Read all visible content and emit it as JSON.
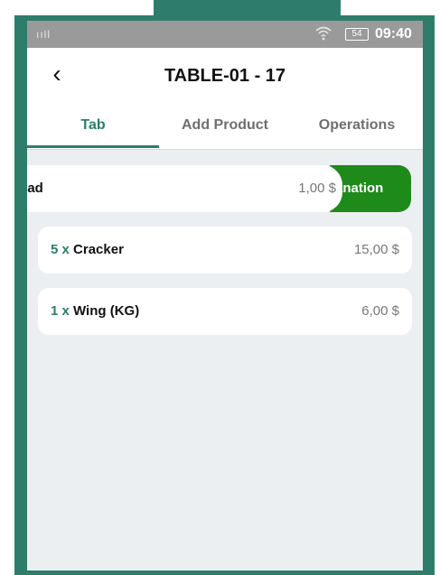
{
  "status_bar": {
    "signal": "ııll",
    "wifi_icon": "wifi-icon",
    "battery": "54",
    "time": "09:40"
  },
  "app_bar": {
    "back_icon": "‹",
    "title": "TABLE-01 - 17"
  },
  "tabs": [
    {
      "label": "Tab",
      "active": true
    },
    {
      "label": "Add Product",
      "active": false
    },
    {
      "label": "Operations",
      "active": false
    }
  ],
  "swiped_item": {
    "label_fragment": "ead",
    "price": "1,00 $",
    "action_fragment": "anation"
  },
  "items": [
    {
      "qty": "5 x",
      "name": "Cracker",
      "price": "15,00 $"
    },
    {
      "qty": "1 x",
      "name": "Wing (KG)",
      "price": "6,00 $"
    }
  ],
  "colors": {
    "accent": "#2e7d6b",
    "action_green": "#1e8a1a",
    "background": "#eceff1"
  }
}
